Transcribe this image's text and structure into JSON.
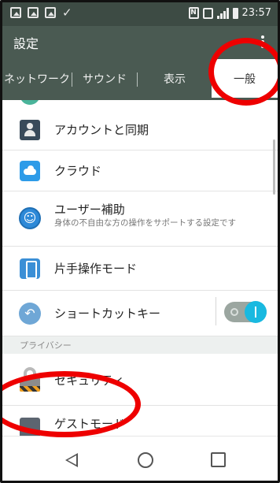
{
  "status_bar": {
    "time": "23:57",
    "icons": [
      "image-icon",
      "image-icon",
      "image-icon",
      "check-icon",
      "nfc-icon",
      "mute-icon",
      "signal-icon",
      "battery-icon"
    ],
    "nfc_label": "N"
  },
  "action_bar": {
    "title": "設定",
    "overflow_icon": "more-vert-icon"
  },
  "tabs": [
    {
      "label": "ネットワーク",
      "selected": false
    },
    {
      "label": "サウンド",
      "selected": false
    },
    {
      "label": "表示",
      "selected": false
    },
    {
      "label": "一般",
      "selected": true
    }
  ],
  "list": {
    "items": [
      {
        "label": "アカウントと同期",
        "icon": "account-icon"
      },
      {
        "label": "クラウド",
        "icon": "cloud-icon"
      },
      {
        "label": "ユーザー補助",
        "sublabel": "身体の不自由な方の操作をサポートする設定です",
        "icon": "accessibility-icon"
      },
      {
        "label": "片手操作モード",
        "icon": "one-hand-icon"
      },
      {
        "label": "ショートカットキー",
        "icon": "shortcut-icon",
        "toggle_on": true
      },
      {
        "label": "セキュリティ",
        "icon": "lock-icon"
      },
      {
        "label": "ゲストモード",
        "icon": "guest-icon"
      }
    ],
    "section_header": "プライバシー"
  },
  "nav_bar": {
    "icons": [
      "back-icon",
      "home-icon",
      "recent-apps-icon"
    ]
  },
  "colors": {
    "header": "#4a5a52",
    "status": "#3d4b44",
    "toggle_accent": "#19b9e0",
    "annotation": "#ee0000"
  }
}
